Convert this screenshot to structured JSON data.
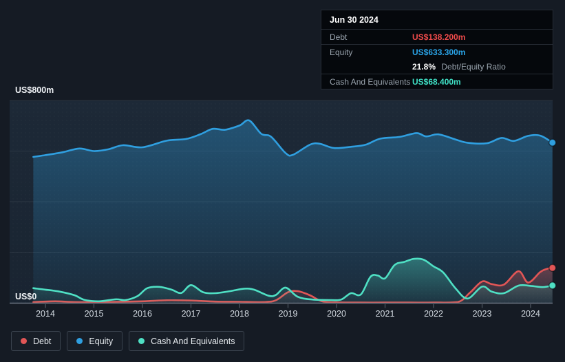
{
  "tooltip": {
    "date": "Jun 30 2024",
    "debt_label": "Debt",
    "debt_value": "US$138.200m",
    "equity_label": "Equity",
    "equity_value": "US$633.300m",
    "ratio_value": "21.8%",
    "ratio_label": "Debt/Equity Ratio",
    "cash_label": "Cash And Equivalents",
    "cash_value": "US$68.400m"
  },
  "axis": {
    "y_top_label": "US$800m",
    "y_zero_label": "US$0"
  },
  "legend": {
    "debt": "Debt",
    "equity": "Equity",
    "cash": "Cash And Equivalents"
  },
  "colors": {
    "debt": "#e25656",
    "debt_text": "#f04b4b",
    "equity": "#2f9fe0",
    "equity_text": "#2aa4e8",
    "cash": "#4fe0c4",
    "cash_text": "#3fe0c5",
    "background": "#151b24",
    "panel": "#1c2836",
    "tooltip_bg": "#05080c",
    "gridline": "rgba(255,255,255,0.08)",
    "baseline": "#6b7581"
  },
  "chart_data": {
    "type": "area",
    "y_unit": "US$ millions",
    "y_range": [
      0,
      800
    ],
    "x_range": [
      2013.75,
      2024.45
    ],
    "x_ticks": [
      2014,
      2015,
      2016,
      2017,
      2018,
      2019,
      2020,
      2021,
      2022,
      2023,
      2024
    ],
    "y_gridlines": [
      800,
      600,
      400,
      200,
      0
    ],
    "draw_order": [
      1,
      0,
      2
    ],
    "series": [
      {
        "name": "Debt",
        "color": "#e25656",
        "end_value": 138.2,
        "points": [
          [
            2013.75,
            3
          ],
          [
            2014.2,
            6
          ],
          [
            2014.6,
            3
          ],
          [
            2015.2,
            3
          ],
          [
            2016.0,
            6
          ],
          [
            2016.5,
            10
          ],
          [
            2017.0,
            9
          ],
          [
            2017.5,
            5
          ],
          [
            2018.0,
            4
          ],
          [
            2018.5,
            3
          ],
          [
            2018.75,
            10
          ],
          [
            2019.0,
            42
          ],
          [
            2019.2,
            46
          ],
          [
            2019.45,
            30
          ],
          [
            2019.7,
            6
          ],
          [
            2020.0,
            2
          ],
          [
            2020.5,
            1
          ],
          [
            2021.0,
            1
          ],
          [
            2021.5,
            1
          ],
          [
            2022.0,
            1
          ],
          [
            2022.5,
            3
          ],
          [
            2022.75,
            40
          ],
          [
            2023.0,
            84
          ],
          [
            2023.2,
            74
          ],
          [
            2023.45,
            72
          ],
          [
            2023.75,
            125
          ],
          [
            2023.95,
            80
          ],
          [
            2024.2,
            122
          ],
          [
            2024.35,
            135
          ],
          [
            2024.45,
            138.2
          ]
        ]
      },
      {
        "name": "Equity",
        "color": "#2f9fe0",
        "end_value": 633.3,
        "points": [
          [
            2013.75,
            577
          ],
          [
            2014.0,
            584
          ],
          [
            2014.35,
            595
          ],
          [
            2014.7,
            610
          ],
          [
            2015.0,
            600
          ],
          [
            2015.3,
            607
          ],
          [
            2015.6,
            623
          ],
          [
            2016.0,
            615
          ],
          [
            2016.5,
            641
          ],
          [
            2016.9,
            648
          ],
          [
            2017.2,
            667
          ],
          [
            2017.45,
            688
          ],
          [
            2017.7,
            684
          ],
          [
            2018.0,
            701
          ],
          [
            2018.2,
            721
          ],
          [
            2018.45,
            668
          ],
          [
            2018.65,
            657
          ],
          [
            2018.95,
            592
          ],
          [
            2019.1,
            585
          ],
          [
            2019.45,
            625
          ],
          [
            2019.65,
            629
          ],
          [
            2019.95,
            612
          ],
          [
            2020.3,
            617
          ],
          [
            2020.6,
            625
          ],
          [
            2020.9,
            649
          ],
          [
            2021.3,
            656
          ],
          [
            2021.65,
            671
          ],
          [
            2021.85,
            658
          ],
          [
            2022.1,
            666
          ],
          [
            2022.45,
            646
          ],
          [
            2022.7,
            633
          ],
          [
            2023.1,
            631
          ],
          [
            2023.4,
            652
          ],
          [
            2023.65,
            640
          ],
          [
            2023.95,
            660
          ],
          [
            2024.2,
            661
          ],
          [
            2024.45,
            633.3
          ]
        ]
      },
      {
        "name": "Cash And Equivalents",
        "color": "#4fe0c4",
        "end_value": 68.4,
        "points": [
          [
            2013.75,
            58
          ],
          [
            2014.0,
            52
          ],
          [
            2014.3,
            44
          ],
          [
            2014.6,
            30
          ],
          [
            2014.8,
            12
          ],
          [
            2015.1,
            6
          ],
          [
            2015.45,
            14
          ],
          [
            2015.65,
            11
          ],
          [
            2015.9,
            27
          ],
          [
            2016.1,
            58
          ],
          [
            2016.35,
            63
          ],
          [
            2016.6,
            52
          ],
          [
            2016.8,
            39
          ],
          [
            2017.0,
            70
          ],
          [
            2017.25,
            42
          ],
          [
            2017.5,
            38
          ],
          [
            2017.8,
            46
          ],
          [
            2018.1,
            56
          ],
          [
            2018.3,
            52
          ],
          [
            2018.6,
            28
          ],
          [
            2018.75,
            31
          ],
          [
            2018.95,
            60
          ],
          [
            2019.2,
            24
          ],
          [
            2019.5,
            13
          ],
          [
            2019.9,
            11
          ],
          [
            2020.1,
            13
          ],
          [
            2020.3,
            38
          ],
          [
            2020.5,
            33
          ],
          [
            2020.7,
            103
          ],
          [
            2020.85,
            108
          ],
          [
            2021.0,
            97
          ],
          [
            2021.2,
            150
          ],
          [
            2021.4,
            162
          ],
          [
            2021.6,
            174
          ],
          [
            2021.8,
            170
          ],
          [
            2022.0,
            144
          ],
          [
            2022.2,
            120
          ],
          [
            2022.45,
            58
          ],
          [
            2022.7,
            17
          ],
          [
            2023.0,
            64
          ],
          [
            2023.2,
            44
          ],
          [
            2023.45,
            38
          ],
          [
            2023.75,
            68
          ],
          [
            2024.0,
            67
          ],
          [
            2024.25,
            62
          ],
          [
            2024.45,
            68.4
          ]
        ]
      }
    ]
  }
}
